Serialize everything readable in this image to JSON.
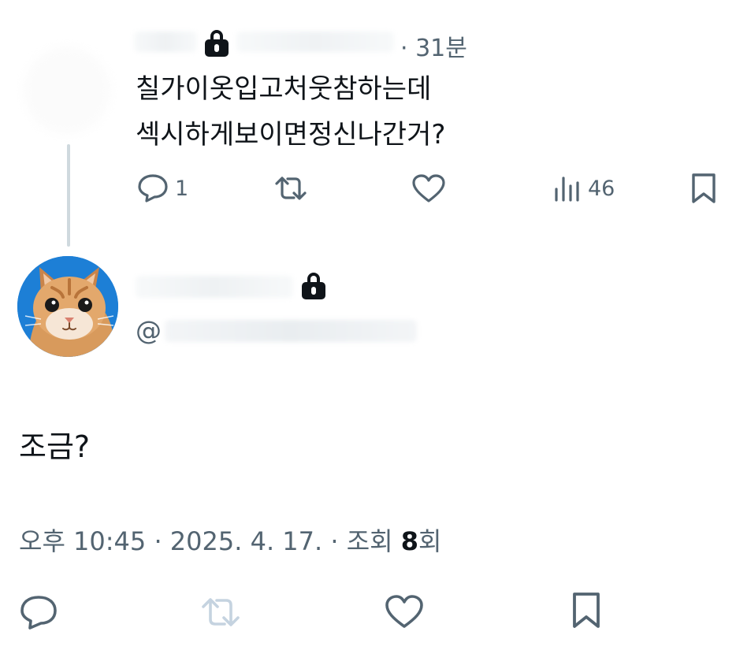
{
  "parent_tweet": {
    "time_ago": "· 31분",
    "text_lines": [
      "칠가이옷입고처웃참하는데",
      "섹시하게보이면정신나간거?"
    ],
    "actions": {
      "reply_count": "1",
      "repost_count": "",
      "like_count": "",
      "view_count": "46"
    }
  },
  "reply_tweet": {
    "handle_prefix": "@",
    "text": "조금?",
    "meta": {
      "time": "오후 10:45",
      "sep1": "·",
      "date": "2025. 4. 17.",
      "sep2": "·",
      "views_label": "조회",
      "views_count": "8",
      "views_suffix": "회"
    }
  },
  "icons": {
    "reply": "reply-icon",
    "repost": "repost-icon",
    "like": "heart-icon",
    "views": "views-chart-icon",
    "bookmark": "bookmark-icon",
    "lock": "lock-icon"
  },
  "colors": {
    "text": "#0f1419",
    "secondary": "#536471",
    "thread_line": "#cfd9de",
    "repost_disabled": "#c5d3e0",
    "avatar_bg": "#1d7fd6"
  }
}
